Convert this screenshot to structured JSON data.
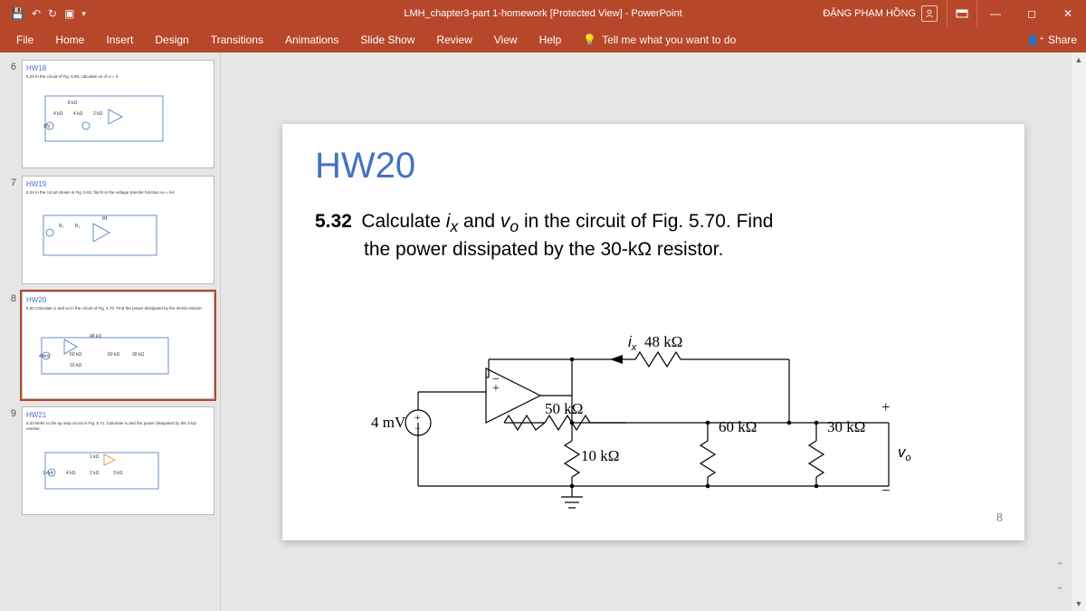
{
  "title_bar": {
    "doc_title": "LMH_chapter3-part 1-homework [Protected View] - PowerPoint",
    "user_name": "ĐẶNG PHẠM HỒNG"
  },
  "ribbon": {
    "tabs": [
      "File",
      "Home",
      "Insert",
      "Design",
      "Transitions",
      "Animations",
      "Slide Show",
      "Review",
      "View",
      "Help"
    ],
    "tell_me": "Tell me what you want to do",
    "share": "Share"
  },
  "thumbnails": [
    {
      "num": "6",
      "title": "HW18",
      "body": "5.20 In the circuit of Fig. 5.59, calculate vo of vi = 0"
    },
    {
      "num": "7",
      "title": "HW19",
      "body": "5.24 In the circuit shown in Fig. 5.62, find k in the voltage transfer function vo = kvi"
    },
    {
      "num": "8",
      "title": "HW20",
      "body": "5.32 Calculate ix and vo in the circuit of Fig. 5.70. Find the power dissipated by the 30-kΩ resistor.",
      "selected": true
    },
    {
      "num": "9",
      "title": "HW21",
      "body": "5.33 Refer to the op amp circuit in Fig. 5.71. Calculate ix and the power dissipated by the 3-kΩ resistor."
    }
  ],
  "slide": {
    "heading": "HW20",
    "problem_num": "5.32",
    "problem_text_1": "Calculate ix and vo in the circuit of Fig. 5.70. Find",
    "problem_text_2": "the power dissipated by the 30-kΩ resistor.",
    "counter": "8"
  },
  "circuit": {
    "source": "4 mV",
    "r_ix_label": "ix",
    "r48": "48 kΩ",
    "r50": "50 kΩ",
    "r10": "10 kΩ",
    "r60": "60 kΩ",
    "r30": "30 kΩ",
    "vo": "vo",
    "plus": "+",
    "minus": "−"
  }
}
